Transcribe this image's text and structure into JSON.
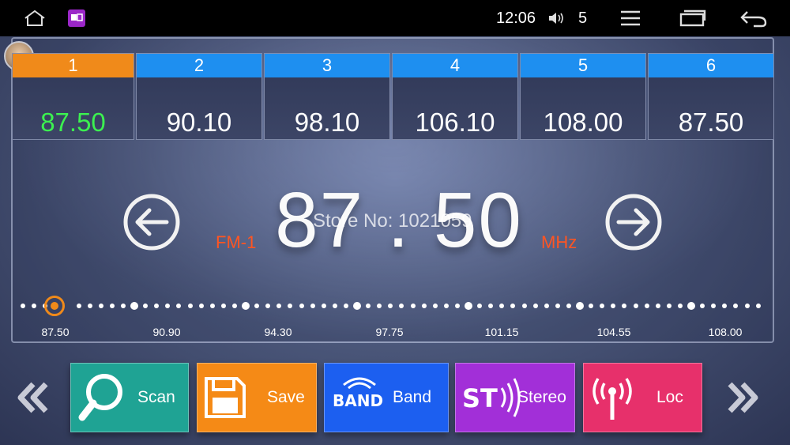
{
  "statusbar": {
    "time": "12:06",
    "volume": "5"
  },
  "presets": [
    {
      "num": "1",
      "freq": "87.50"
    },
    {
      "num": "2",
      "freq": "90.10"
    },
    {
      "num": "3",
      "freq": "98.10"
    },
    {
      "num": "4",
      "freq": "106.10"
    },
    {
      "num": "5",
      "freq": "108.00"
    },
    {
      "num": "6",
      "freq": "87.50"
    }
  ],
  "tuner": {
    "frequency": "87 . 50",
    "band": "FM-1",
    "unit": "MHz",
    "watermark": "Store No: 1021059"
  },
  "dial": {
    "ticks": [
      "87.50",
      "90.90",
      "94.30",
      "97.75",
      "101.15",
      "104.55",
      "108.00"
    ]
  },
  "buttons": {
    "scan": "Scan",
    "save": "Save",
    "band": "Band",
    "band_icon_text": "BAND",
    "stereo": "Stereo",
    "stereo_icon_text": "ST",
    "loc": "Loc"
  },
  "colors": {
    "preset_header": "#1e8ff0",
    "active_header": "#f08a1a",
    "active_freq": "#3cf050",
    "accent_label": "#ff5522"
  }
}
